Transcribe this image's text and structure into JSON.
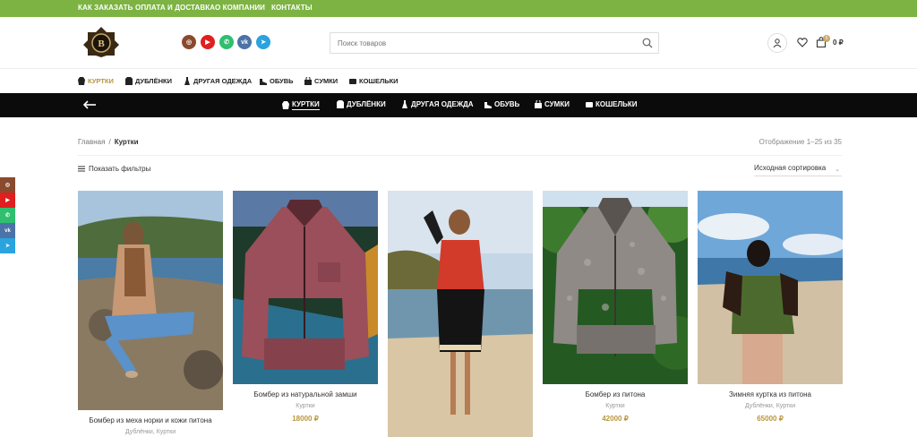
{
  "topbar": {
    "links": [
      "КАК ЗАКАЗАТЬ",
      "ОПЛАТА И ДОСТАВКА",
      "О КОМПАНИИ",
      "КОНТАКТЫ"
    ]
  },
  "header": {
    "logo_letter": "B",
    "social": [
      {
        "icon": "instagram-icon",
        "glyph": "◎",
        "color": "#8a4a2e"
      },
      {
        "icon": "youtube-icon",
        "glyph": "▶",
        "color": "#e01f1f"
      },
      {
        "icon": "whatsapp-icon",
        "glyph": "✆",
        "color": "#2fbf6f"
      },
      {
        "icon": "vk-icon",
        "glyph": "vk",
        "color": "#4b73a8"
      },
      {
        "icon": "telegram-icon",
        "glyph": "➤",
        "color": "#2aa3de"
      }
    ],
    "search_placeholder": "Поиск товаров",
    "cart_count": "0",
    "cart_total": "0 ₽"
  },
  "categories": [
    {
      "label": "КУРТКИ",
      "icon": "jacket-icon",
      "active": true
    },
    {
      "label": "ДУБЛЁНКИ",
      "icon": "coat-icon",
      "active": false
    },
    {
      "label": "ДРУГАЯ ОДЕЖДА",
      "icon": "dress-icon",
      "active": false
    },
    {
      "label": "ОБУВЬ",
      "icon": "shoe-icon",
      "active": false
    },
    {
      "label": "СУМКИ",
      "icon": "bag-icon",
      "active": false
    },
    {
      "label": "КОШЕЛЬКИ",
      "icon": "wallet-icon",
      "active": false
    }
  ],
  "breadcrumb": {
    "home": "Главная",
    "separator": "/",
    "current": "Куртки"
  },
  "results_count": "Отображение 1–25 из 35",
  "filters_label": "Показать фильтры",
  "sort": {
    "selected": "Исходная сортировка"
  },
  "products": [
    {
      "name": "Бомбер из меха норки и кожи питона",
      "category": "Дублёнки, Куртки",
      "price": ""
    },
    {
      "name": "Бомбер из натуральной замши",
      "category": "Куртки",
      "price": "18000 ₽"
    },
    {
      "name": "",
      "category": "",
      "price": ""
    },
    {
      "name": "Бомбер из питона",
      "category": "Куртки",
      "price": "42000 ₽"
    },
    {
      "name": "Зимняя куртка из питона",
      "category": "Дублёнки, Куртки",
      "price": "65000 ₽"
    }
  ],
  "side_social": [
    {
      "icon": "instagram-icon",
      "glyph": "◎",
      "color": "#8a4a2e"
    },
    {
      "icon": "youtube-icon",
      "glyph": "▶",
      "color": "#e01f1f"
    },
    {
      "icon": "whatsapp-icon",
      "glyph": "✆",
      "color": "#2fbf6f"
    },
    {
      "icon": "vk-icon",
      "glyph": "vk",
      "color": "#4b73a8"
    },
    {
      "icon": "telegram-icon",
      "glyph": "➤",
      "color": "#2aa3de"
    }
  ],
  "colors": {
    "green": "#7cb342",
    "gold": "#b8963e",
    "black": "#0b0b0b"
  }
}
